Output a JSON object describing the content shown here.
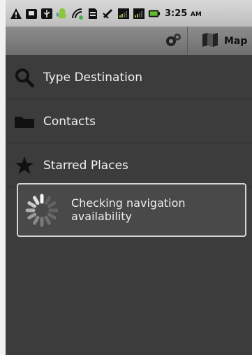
{
  "status_bar": {
    "time": "3:25",
    "ampm": "AM",
    "icons": [
      "warning-icon",
      "briefcase-icon",
      "usb-icon",
      "android-icon",
      "location-icon",
      "sd-card-icon",
      "signal-off-icon",
      "signal-bars-icon",
      "signal-bars-icon",
      "battery-icon"
    ]
  },
  "action_bar": {
    "map_label": "Map"
  },
  "menu": {
    "items": [
      {
        "label": "Type Destination",
        "icon": "search-icon"
      },
      {
        "label": "Contacts",
        "icon": "folder-icon"
      },
      {
        "label": "Starred Places",
        "icon": "star-icon"
      }
    ]
  },
  "dialog": {
    "message": "Checking navigation availability"
  }
}
